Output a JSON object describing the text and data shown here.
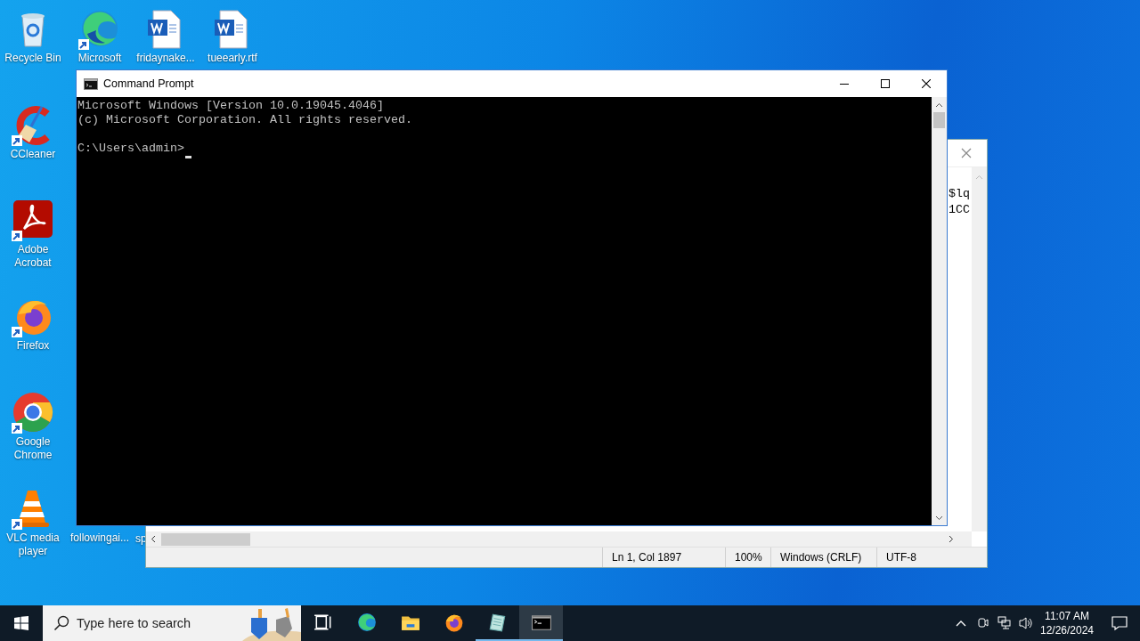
{
  "desktop_icons": [
    {
      "label": "Recycle Bin",
      "kind": "recycle"
    },
    {
      "label": "Microsoft",
      "kind": "edge",
      "shortcut": true
    },
    {
      "label": "fridaynake...",
      "kind": "word"
    },
    {
      "label": "tueearly.rtf",
      "kind": "word"
    },
    {
      "label": "CCleaner",
      "kind": "ccleaner",
      "shortcut": true
    },
    {
      "label": "Adobe Acrobat",
      "kind": "acrobat",
      "shortcut": true
    },
    {
      "label": "Firefox",
      "kind": "firefox",
      "shortcut": true
    },
    {
      "label": "Google Chrome",
      "kind": "chrome",
      "shortcut": true
    },
    {
      "label": "VLC media player",
      "kind": "vlc",
      "shortcut": true
    },
    {
      "label": "followingai..."
    },
    {
      "label": "sp"
    }
  ],
  "notepad": {
    "text_lines": [
      "$lq",
      "1CC"
    ],
    "status_bar": [
      "Ln 1, Col 1897",
      "100%",
      "Windows (CRLF)",
      "UTF-8"
    ]
  },
  "command_prompt": {
    "title": "Command Prompt",
    "output_lines": [
      "Microsoft Windows [Version 10.0.19045.4046]",
      "(c) Microsoft Corporation. All rights reserved."
    ],
    "prompt": "C:\\Users\\admin>",
    "cursor": true
  },
  "taskbar": {
    "search": {
      "placeholder": "Type here to search"
    },
    "apps": [
      {
        "kind": "taskview",
        "running": false,
        "selected": false
      },
      {
        "kind": "edge",
        "running": false,
        "selected": false
      },
      {
        "kind": "explorer",
        "running": false,
        "selected": false
      },
      {
        "kind": "firefox",
        "running": false,
        "selected": false
      },
      {
        "kind": "notepad",
        "running": true,
        "selected": false
      },
      {
        "kind": "cmd",
        "running": true,
        "selected": true
      }
    ],
    "clock": {
      "time": "11:07 AM",
      "date": "12/26/2024"
    }
  }
}
